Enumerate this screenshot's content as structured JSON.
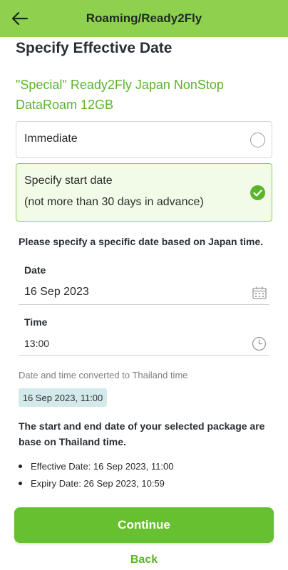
{
  "header": {
    "title": "Roaming/Ready2Fly",
    "back_icon": "arrow-left-icon",
    "background_color": "#8ed14f"
  },
  "page": {
    "title": "Specify Effective Date",
    "package_name": "\"Special\" Ready2Fly Japan NonStop DataRoam 12GB"
  },
  "options": {
    "immediate": {
      "label": "Immediate",
      "selected": false
    },
    "specify": {
      "label_line1": "Specify start date",
      "label_line2": "(not more than 30 days in advance)",
      "selected": true
    }
  },
  "instruction": "Please specify a specific date based on Japan time.",
  "date_field": {
    "label": "Date",
    "value": "16 Sep 2023",
    "icon": "calendar-icon"
  },
  "time_field": {
    "label": "Time",
    "value": "13:00",
    "icon": "clock-icon"
  },
  "converted": {
    "label": "Date and time converted to Thailand time",
    "value": "16 Sep 2023, 11:00"
  },
  "note": "The start and end date of your selected package are base on Thailand time.",
  "details": [
    {
      "text": "Effective Date: 16 Sep 2023, 11:00"
    },
    {
      "text": "Expiry Date: 26 Sep 2023, 10:59"
    }
  ],
  "actions": {
    "continue_label": "Continue",
    "back_label": "Back"
  },
  "colors": {
    "accent": "#5ab52a",
    "button": "#66c030",
    "badge": "#d4e9e9"
  }
}
